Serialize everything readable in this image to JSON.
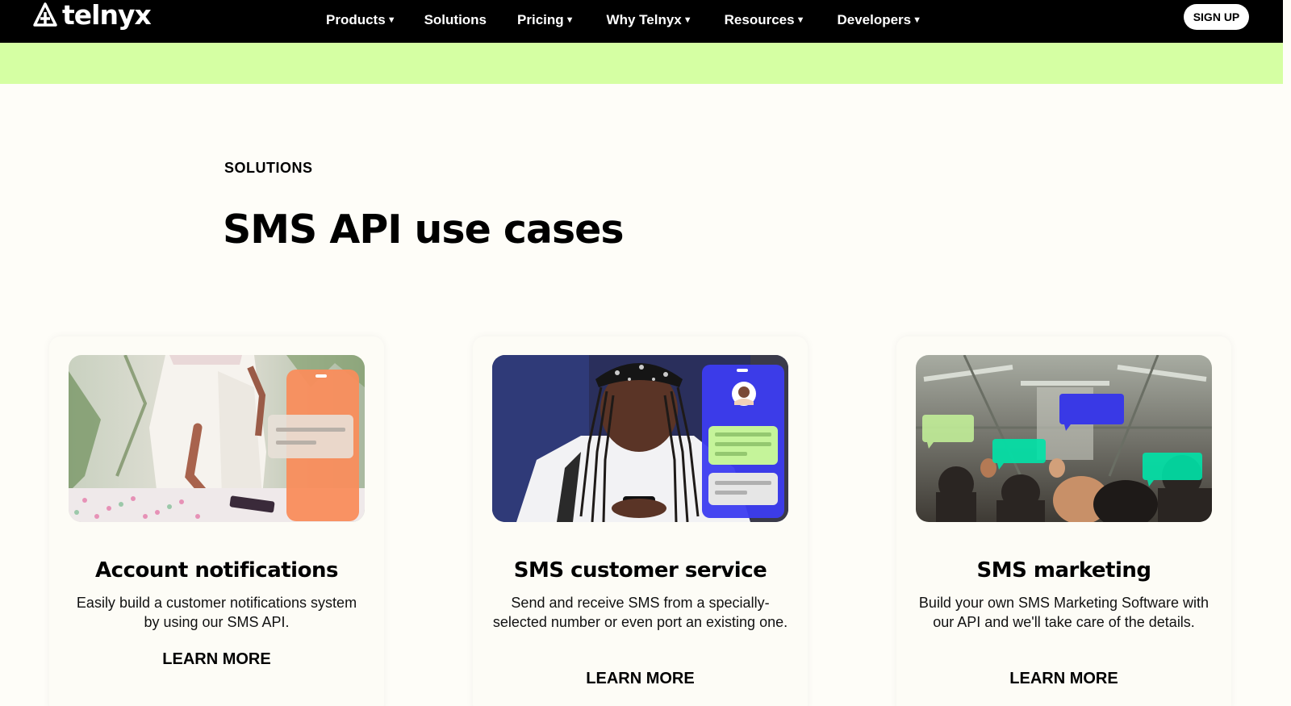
{
  "nav": {
    "logo_text": "telnyx",
    "links": [
      {
        "label": "Products",
        "caret": "▼"
      },
      {
        "label": "Solutions",
        "caret": ""
      },
      {
        "label": "Pricing",
        "caret": "▼"
      },
      {
        "label": "Why Telnyx",
        "caret": "▼"
      },
      {
        "label": "Resources",
        "caret": "▼"
      },
      {
        "label": "Developers",
        "caret": "▼"
      }
    ],
    "signup_label": "SIGN UP"
  },
  "section": {
    "eyebrow": "SOLUTIONS",
    "title": "SMS API use cases"
  },
  "cards": [
    {
      "title": "Account notifications",
      "description": "Easily build a customer notifications system by using our SMS API.",
      "cta": "LEARN MORE",
      "image": "woman-with-phone-notification-photo"
    },
    {
      "title": "SMS customer service",
      "description": "Send and receive SMS from a specially-selected number or even port an existing one.",
      "cta": "LEARN MORE",
      "image": "girl-texting-chat-photo"
    },
    {
      "title": "SMS marketing",
      "description": "Build your own SMS Marketing Software with our API and we'll take care of the details.",
      "cta": "LEARN MORE",
      "image": "subway-commuters-messages-photo"
    }
  ],
  "colors": {
    "nav_bg": "#000000",
    "banner": "#d5ffa3",
    "page_bg": "#fefdf8",
    "accent_orange": "#f98d5c",
    "accent_blue": "#3939e6",
    "accent_green": "#00e3a8",
    "accent_lime": "#c5f49a"
  }
}
